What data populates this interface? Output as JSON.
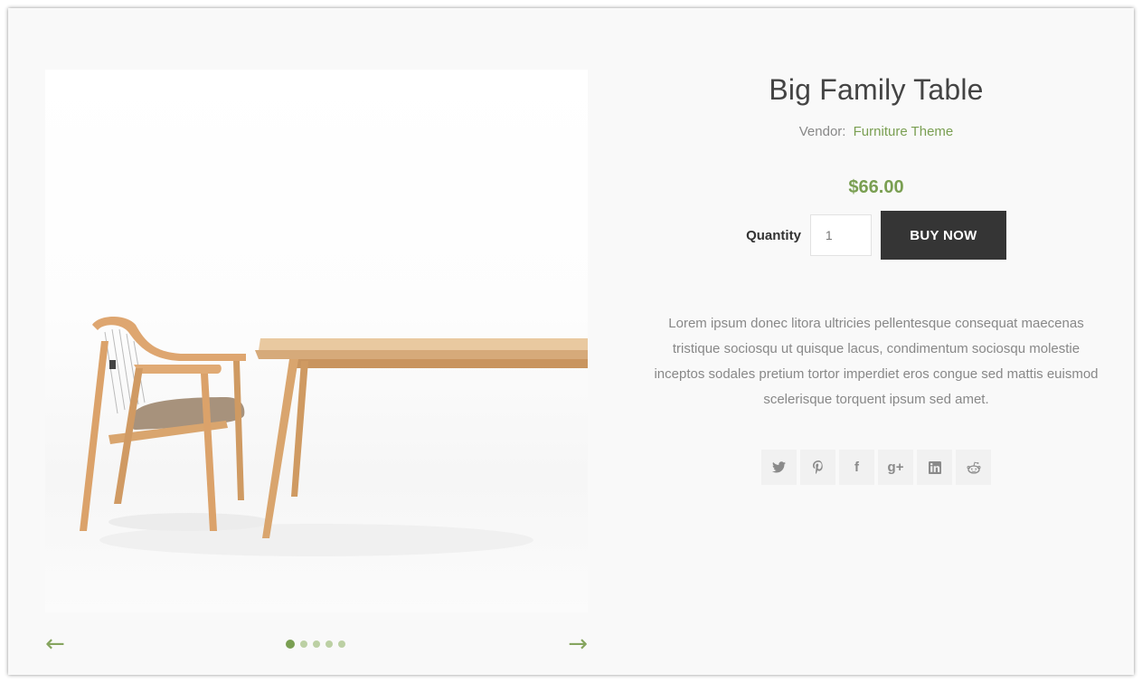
{
  "product": {
    "title": "Big Family Table",
    "vendor_label": "Vendor:",
    "vendor_name": "Furniture Theme",
    "price": "$66.00",
    "quantity_label": "Quantity",
    "quantity_value": "1",
    "buy_label": "BUY NOW",
    "description": "Lorem ipsum donec litora ultricies pellentesque consequat maecenas tristique sociosqu ut quisque lacus, condimentum sociosqu molestie inceptos sodales pretium tortor imperdiet eros congue sed mattis euismod scelerisque torquent ipsum sed amet."
  },
  "gallery": {
    "image_alt": "product-photo-chair-and-table",
    "prev_arrow": "←",
    "next_arrow": "→",
    "slide_count": 5,
    "active_slide": 1
  },
  "share": {
    "icons": [
      "twitter-icon",
      "pinterest-icon",
      "facebook-icon",
      "google-plus-icon",
      "linkedin-icon",
      "reddit-icon"
    ],
    "facebook_glyph": "f",
    "google_plus_glyph": "g+"
  },
  "colors": {
    "accent": "#7a9f52",
    "button_bg": "#353535",
    "text_muted": "#888888",
    "page_bg": "#f9f9f9"
  }
}
